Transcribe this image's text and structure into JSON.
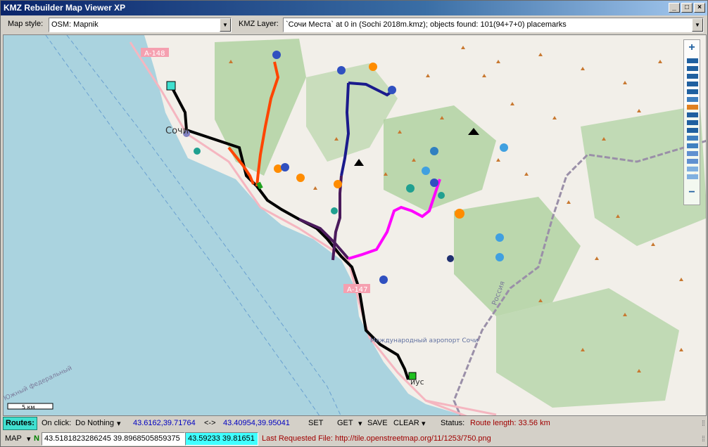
{
  "window": {
    "title": "KMZ Rebuilder Map Viewer XP"
  },
  "toolbar": {
    "map_style_label": "Map style:",
    "map_style_value": "OSM: Mapnik",
    "kmz_layer_label": "KMZ Layer:",
    "kmz_layer_value": "`Сочи Места` at 0 in (Sochi 2018m.kmz); objects found: 101(94+7+0) placemarks"
  },
  "map": {
    "labels": {
      "sochi": "Сочи",
      "a148": "А-148",
      "a147": "А-147",
      "airport": "Международный аэропорт Сочи",
      "adler": "иус",
      "russia": "Россия",
      "south_district": "Южный федеральный"
    },
    "scale": "5 км",
    "colors": {
      "sea": "#aad3df",
      "land": "#f2efe9",
      "forest": "#add19e",
      "route_black": "#000000",
      "route_orange": "#ff4500",
      "route_navy": "#1a1a8c",
      "route_purple": "#4b1a5c",
      "route_magenta": "#ff00ff",
      "route_green": "#20a020"
    }
  },
  "status1": {
    "routes_label": "Routes:",
    "on_click_label": "On click:",
    "on_click_value": "Do Nothing",
    "coord1": "43.6162,39.71764",
    "arrows": "<->",
    "coord2": "43.40954,39.95041",
    "set": "SET",
    "get": "GET",
    "save": "SAVE",
    "clear": "CLEAR",
    "status_label": "Status:",
    "status_value": "Route length: 33.56 km"
  },
  "status2": {
    "map_label": "MAP",
    "n_label": "N",
    "lat_lon": "43.5181823286245  39.8968505859375",
    "cursor": "43.59233  39.81651",
    "last_request": "Last Requested File: http://tile.openstreetmap.org/11/1253/750.png"
  }
}
